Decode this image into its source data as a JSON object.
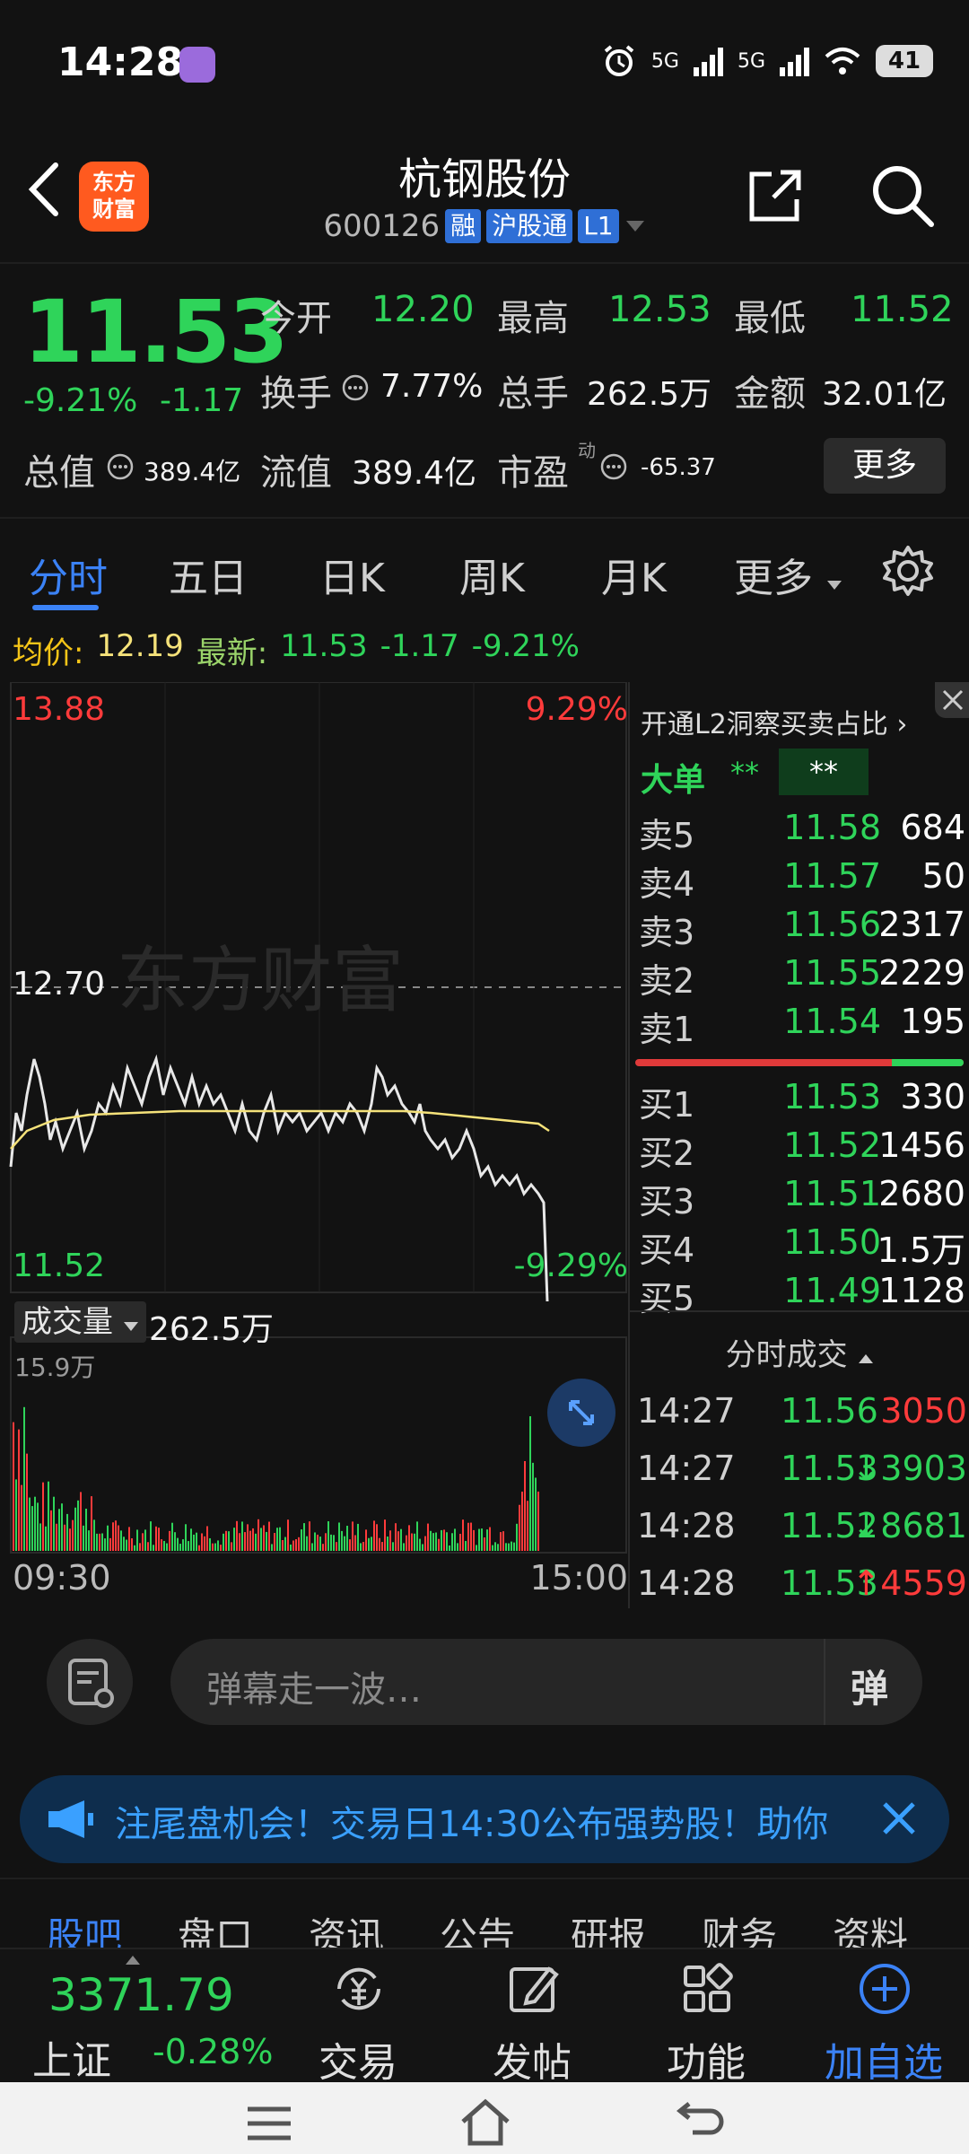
{
  "status": {
    "time": "14:28",
    "battery": "41",
    "net1": "5G",
    "net2": "5G"
  },
  "header": {
    "logo_line1": "东方",
    "logo_line2": "财富",
    "stock_name": "杭钢股份",
    "code": "600126",
    "tags": [
      "融",
      "沪股通",
      "L1"
    ]
  },
  "quote": {
    "price": "11.53",
    "change_pct": "-9.21%",
    "change": "-1.17",
    "open_label": "今开",
    "open": "12.20",
    "high_label": "最高",
    "high": "12.53",
    "low_label": "最低",
    "low": "11.52",
    "turnover_label": "换手",
    "turnover": "7.77%",
    "volume_label": "总手",
    "volume": "262.5万",
    "amount_label": "金额",
    "amount": "32.01亿",
    "mktcap_label": "总值",
    "mktcap": "389.4亿",
    "float_label": "流值",
    "float_cap": "389.4亿",
    "pe_label": "市盈",
    "pe_sup": "动",
    "pe": "-65.37",
    "more_label": "更多"
  },
  "tabs": [
    "分时",
    "五日",
    "日K",
    "周K",
    "月K",
    "更多"
  ],
  "info_line": {
    "avg_label": "均价:",
    "avg": "12.19",
    "latest_label": "最新:",
    "latest": "11.53",
    "change": "-1.17",
    "pct": "-9.21%"
  },
  "chart": {
    "top_price": "13.88",
    "top_pct": "9.29%",
    "mid_price": "12.70",
    "bottom_price": "11.52",
    "bottom_pct": "-9.29%",
    "watermark": "东方财富",
    "volume_label": "成交量",
    "volume_total": "262.5万",
    "volume_max": "15.9万",
    "time_start": "09:30",
    "time_end": "15:00"
  },
  "order_panel": {
    "l2_promo": "开通L2洞察买卖占比",
    "big_order_label": "大单",
    "big_order_v1": "**",
    "big_order_v2": "**",
    "asks": [
      {
        "label": "卖5",
        "price": "11.58",
        "vol": "684"
      },
      {
        "label": "卖4",
        "price": "11.57",
        "vol": "50"
      },
      {
        "label": "卖3",
        "price": "11.56",
        "vol": "2317"
      },
      {
        "label": "卖2",
        "price": "11.55",
        "vol": "2229"
      },
      {
        "label": "卖1",
        "price": "11.54",
        "vol": "195"
      }
    ],
    "bids": [
      {
        "label": "买1",
        "price": "11.53",
        "vol": "330"
      },
      {
        "label": "买2",
        "price": "11.52",
        "vol": "1456"
      },
      {
        "label": "买3",
        "price": "11.51",
        "vol": "2680"
      },
      {
        "label": "买4",
        "price": "11.50",
        "vol": "1.5万"
      },
      {
        "label": "买5",
        "price": "11.49",
        "vol": "1128"
      }
    ],
    "ticks_title": "分时成交",
    "ticks": [
      {
        "time": "14:27",
        "price": "11.56",
        "vol": "3050",
        "dir": ""
      },
      {
        "time": "14:27",
        "price": "11.53",
        "vol": "3903",
        "dir": "↓"
      },
      {
        "time": "14:28",
        "price": "11.52",
        "vol": "8681",
        "dir": "↓"
      },
      {
        "time": "14:28",
        "price": "11.53",
        "vol": "4559",
        "dir": "↑"
      }
    ]
  },
  "comment": {
    "placeholder": "弹幕走一波…",
    "danmaku_label": "弹"
  },
  "banner": {
    "text": "注尾盘机会！交易日14:30公布强势股！助你"
  },
  "sub_tabs": [
    "股吧",
    "盘口",
    "资讯",
    "公告",
    "研报",
    "财务",
    "资料"
  ],
  "bottom": {
    "index_value": "3371.79",
    "index_name": "上证",
    "index_pct": "-0.28%",
    "items": [
      {
        "label": "交易",
        "icon": "trade-icon"
      },
      {
        "label": "发帖",
        "icon": "edit-icon"
      },
      {
        "label": "功能",
        "icon": "grid-icon"
      },
      {
        "label": "加自选",
        "icon": "add-circle-icon"
      }
    ]
  },
  "colors": {
    "up": "#ff3b3b",
    "down": "#2fd45a",
    "accent": "#3b82f6",
    "bg": "#121212"
  }
}
